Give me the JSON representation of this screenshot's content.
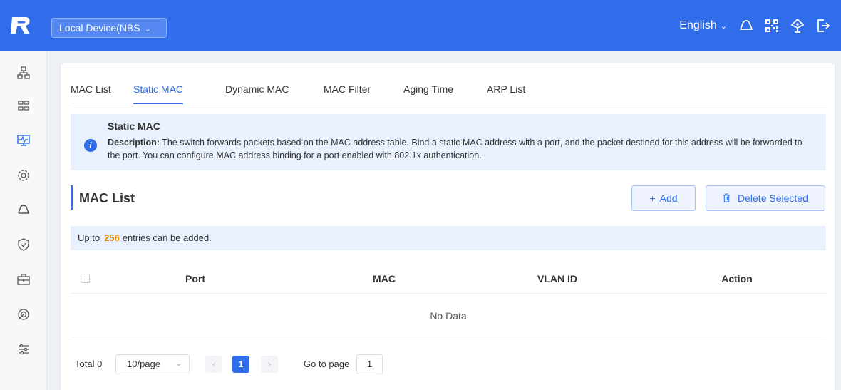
{
  "header": {
    "device_select": "Local Device(NBS",
    "language": "English"
  },
  "icons": {
    "top": [
      "cloud-icon",
      "qr-code-icon",
      "network-icon",
      "logout-icon"
    ],
    "sidebar": [
      "topology-icon",
      "ports-icon",
      "monitor-icon",
      "settings-icon",
      "cloud-icon",
      "security-icon",
      "toolbox-icon",
      "wireless-icon",
      "config-icon"
    ]
  },
  "colors": {
    "brand": "#2f6dea",
    "accent_count": "#f08300"
  },
  "tabs": [
    {
      "label": "MAC List",
      "active": false
    },
    {
      "label": "Static MAC",
      "active": true
    },
    {
      "label": "Dynamic MAC",
      "active": false
    },
    {
      "label": "MAC Filter",
      "active": false
    },
    {
      "label": "Aging Time",
      "active": false
    },
    {
      "label": "ARP List",
      "active": false
    }
  ],
  "info": {
    "title": "Static MAC",
    "desc_label": "Description:",
    "desc_text": "The switch forwards packets based on the MAC address table. Bind a static MAC address with a port, and the packet destined for this address will be forwarded to the port. You can configure MAC address binding for a port enabled with 802.1x authentication."
  },
  "section": {
    "title": "MAC List",
    "add_label": "Add",
    "delete_label": "Delete Selected"
  },
  "limit": {
    "prefix": "Up to",
    "count": "256",
    "suffix": "entries can be added."
  },
  "table": {
    "columns": [
      "Port",
      "MAC",
      "VLAN ID",
      "Action"
    ],
    "empty_text": "No Data"
  },
  "pagination": {
    "total_label": "Total 0",
    "page_size": "10/page",
    "current_page": "1",
    "goto_label": "Go to page",
    "goto_value": "1"
  }
}
